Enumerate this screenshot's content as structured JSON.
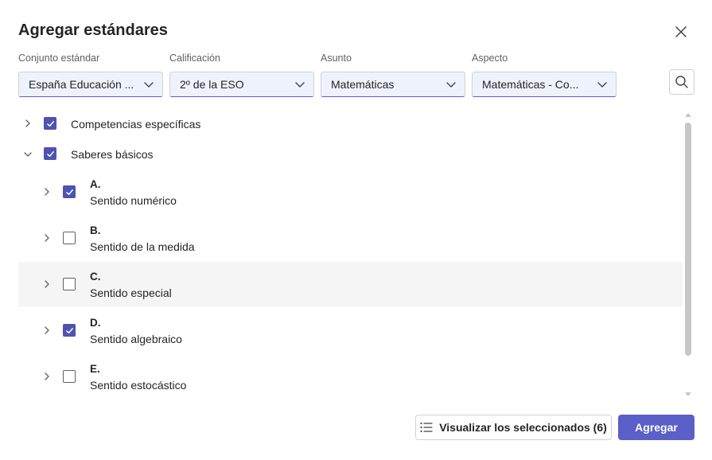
{
  "dialog": {
    "title": "Agregar estándares",
    "close_icon": "close-icon"
  },
  "filters": [
    {
      "label": "Conjunto estándar",
      "value": "España Educación ..."
    },
    {
      "label": "Calificación",
      "value": "2º de la ESO"
    },
    {
      "label": "Asunto",
      "value": "Matemáticas"
    },
    {
      "label": "Aspecto",
      "value": "Matemáticas - Co..."
    }
  ],
  "search": {
    "icon": "search-icon"
  },
  "tree": {
    "top": [
      {
        "label": "Competencias específicas",
        "checked": true,
        "expanded": false
      },
      {
        "label": "Saberes básicos",
        "checked": true,
        "expanded": true
      }
    ],
    "children": [
      {
        "code": "A.",
        "desc": "Sentido numérico",
        "checked": true
      },
      {
        "code": "B.",
        "desc": "Sentido de la medida",
        "checked": false
      },
      {
        "code": "C.",
        "desc": "Sentido especial",
        "checked": false
      },
      {
        "code": "D.",
        "desc": "Sentido algebraico",
        "checked": true
      },
      {
        "code": "E.",
        "desc": "Sentido estocástico",
        "checked": false
      }
    ]
  },
  "footer": {
    "view_selected_label": "Visualizar los seleccionados (6)",
    "add_label": "Agregar"
  },
  "colors": {
    "accent": "#5b5fc7",
    "checkbox_checked": "#4f52b2",
    "select_bg": "#eef2fd",
    "row_highlight": "#f5f5f5"
  }
}
